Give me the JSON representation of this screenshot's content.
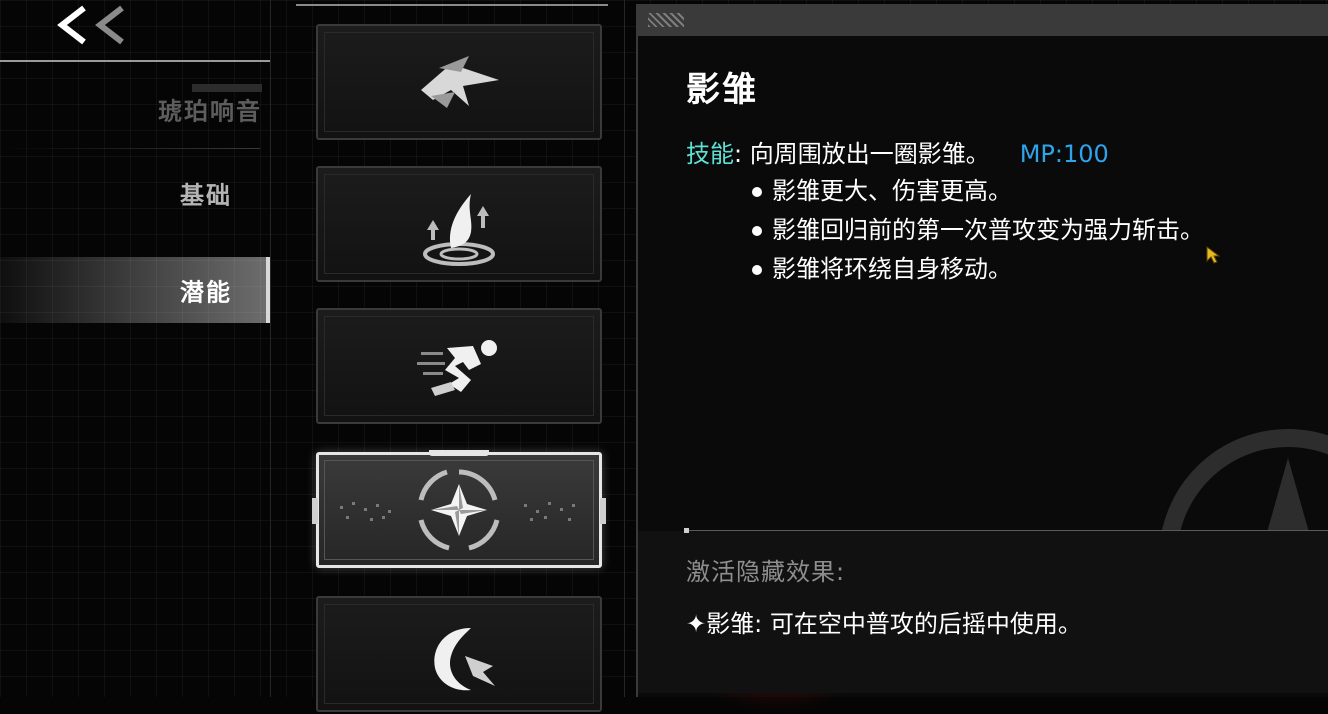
{
  "nav": {
    "tabs": [
      {
        "label": "琥珀响音"
      },
      {
        "label": "基础"
      },
      {
        "label": "潜能"
      }
    ]
  },
  "cards": [
    {
      "icon": "dash-arrow-icon"
    },
    {
      "icon": "leap-feather-icon"
    },
    {
      "icon": "running-figure-icon"
    },
    {
      "icon": "shuriken-swirl-icon",
      "selected": true
    },
    {
      "icon": "crescent-slash-icon"
    }
  ],
  "detail": {
    "title": "影雏",
    "skill_key": "技能",
    "skill_desc": ": 向周围放出一圈影雏。",
    "mp": "MP:100",
    "bullets": [
      "影雏更大、伤害更高。",
      "影雏回归前的第一次普攻变为强力斩击。",
      "影雏将环绕自身移动。"
    ],
    "hidden_label": "激活隐藏效果:",
    "hidden_effect": "✦影雏: 可在空中普攻的后摇中使用。"
  },
  "colors": {
    "skill_key": "#5ee0d4",
    "mp": "#2fa4ec",
    "selected_border": "#e6e6e6"
  }
}
